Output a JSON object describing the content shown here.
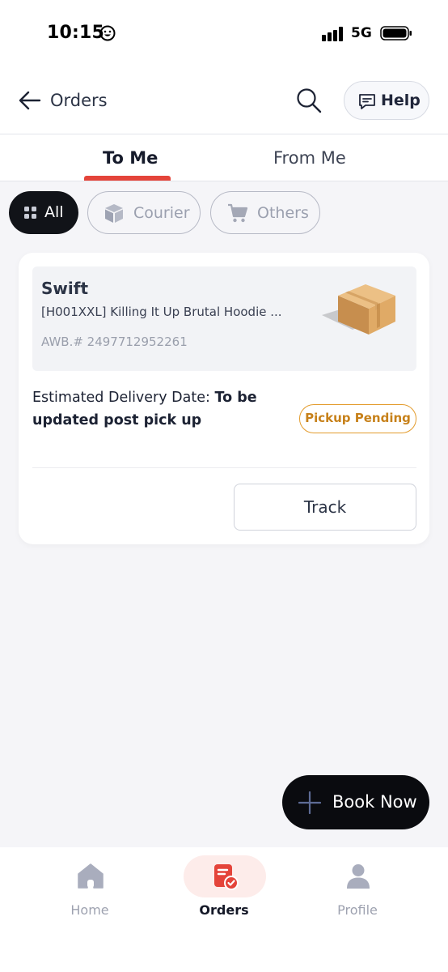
{
  "status_bar": {
    "time": "10:15",
    "network": "5G"
  },
  "header": {
    "title": "Orders",
    "help_label": "Help"
  },
  "tabs": [
    {
      "label": "To Me",
      "active": true
    },
    {
      "label": "From Me",
      "active": false
    }
  ],
  "filters": [
    {
      "label": "All",
      "selected": true,
      "icon": "grid-icon"
    },
    {
      "label": "Courier",
      "selected": false,
      "icon": "box-icon"
    },
    {
      "label": "Others",
      "selected": false,
      "icon": "cart-icon"
    }
  ],
  "order": {
    "carrier": "Swift",
    "product": "[H001XXL] Killing It Up Brutal Hoodie ...",
    "awb": "AWB.# 2497712952261",
    "eta_prefix": "Estimated Delivery Date: ",
    "eta_value": "To be updated post pick up",
    "status": "Pickup Pending",
    "track_label": "Track"
  },
  "fab": {
    "label": "Book Now"
  },
  "bottom_nav": [
    {
      "label": "Home",
      "icon": "home-icon",
      "active": false
    },
    {
      "label": "Orders",
      "icon": "orders-icon",
      "active": true
    },
    {
      "label": "Profile",
      "icon": "profile-icon",
      "active": false
    }
  ],
  "colors": {
    "accent": "#e4443a",
    "badge": "#e39c2d",
    "dark": "#0a0b0f"
  }
}
